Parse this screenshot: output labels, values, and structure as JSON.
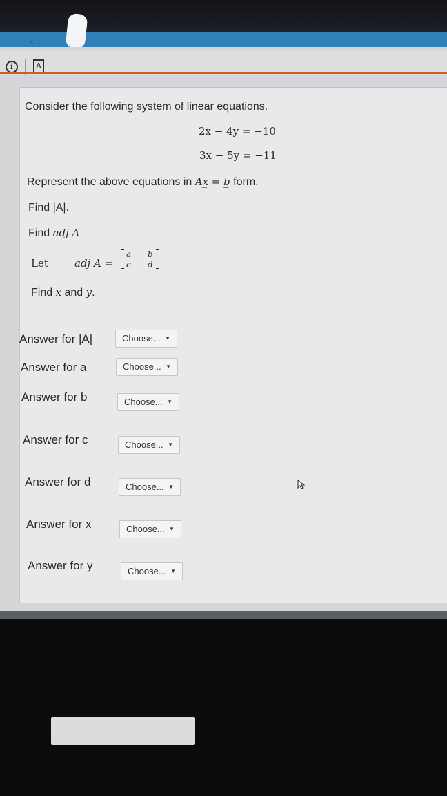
{
  "browser": {
    "tab_close": "×",
    "page_icon_letter": "A"
  },
  "question": {
    "intro": "Consider the following system of linear equations.",
    "eq1": "2x − 4y = −10",
    "eq2": "3x − 5y = −11",
    "represent_pre": "Represent the above equations in ",
    "represent_math": "Ax̲ = b̲",
    "represent_post": " form.",
    "find_det": "Find |A|.",
    "find_adj_pre": "Find ",
    "find_adj_math": "adj A",
    "let_word": "Let",
    "let_math": "adj A =",
    "matrix": {
      "a": "a",
      "b": "b",
      "c": "c",
      "d": "d"
    },
    "find_xy_pre": "Find ",
    "find_xy_x": "x",
    "find_xy_mid": " and ",
    "find_xy_y": "y",
    "find_xy_post": "."
  },
  "answers": [
    {
      "label": "Answer for |A|",
      "value": "Choose..."
    },
    {
      "label": "Answer for a",
      "value": "Choose..."
    },
    {
      "label": "Answer for b",
      "value": "Choose..."
    },
    {
      "label": "Answer for c",
      "value": "Choose..."
    },
    {
      "label": "Answer for d",
      "value": "Choose..."
    },
    {
      "label": "Answer for x",
      "value": "Choose..."
    },
    {
      "label": "Answer for y",
      "value": "Choose..."
    }
  ],
  "icons": {
    "info": "info-icon",
    "page": "page-icon",
    "dropdown_arrow": "▼",
    "mouse_cursor": "mouse-cursor-icon"
  },
  "colors": {
    "accent_tab": "#2f7fb9",
    "accent_line": "#c9602a",
    "panel_bg": "#e7e9ea"
  }
}
